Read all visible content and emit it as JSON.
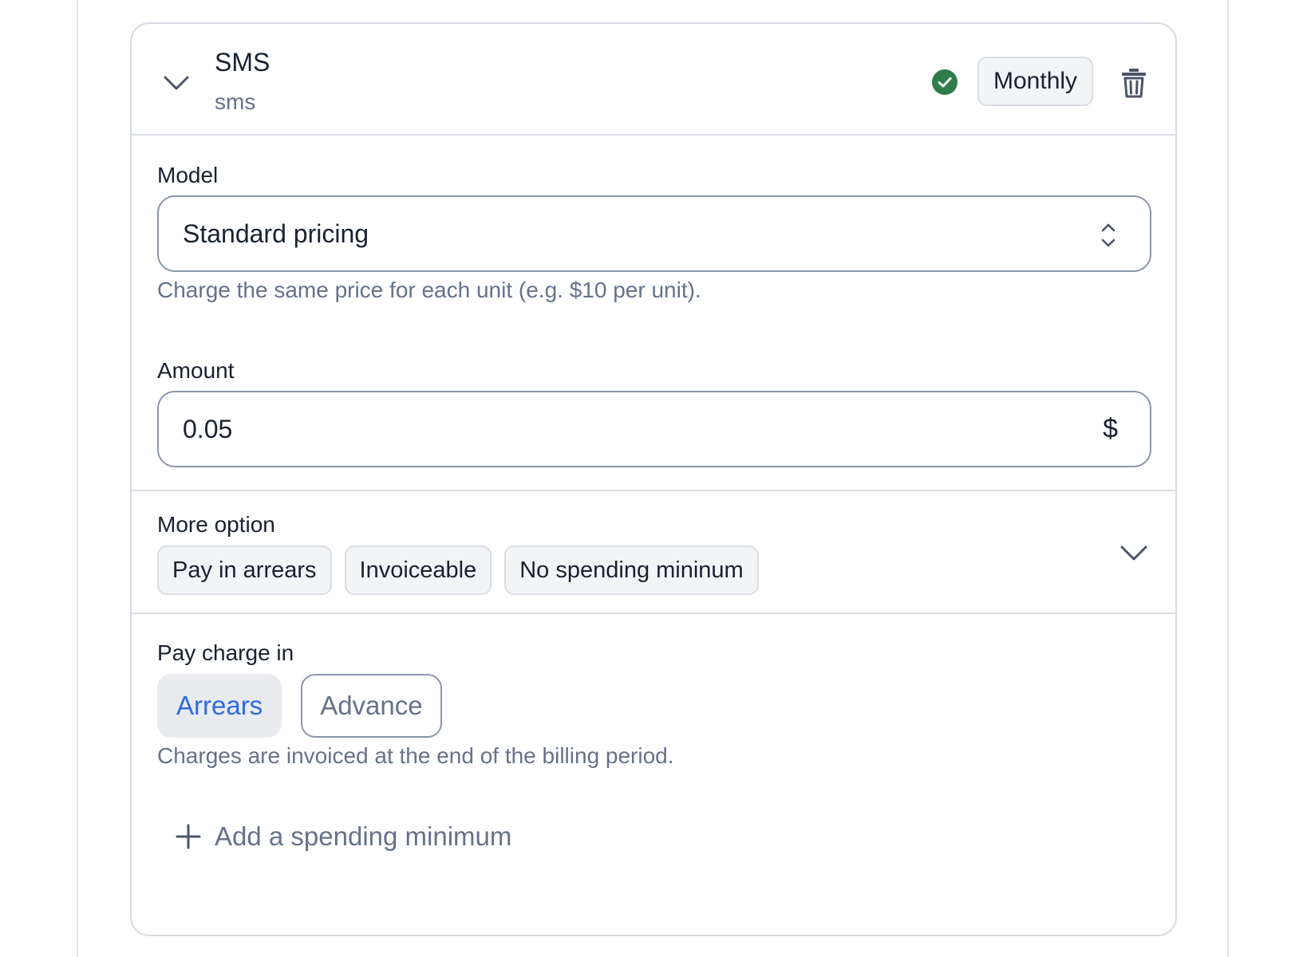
{
  "charge": {
    "title": "SMS",
    "code": "sms",
    "status_icon": "check-circle-icon",
    "status_color": "#2f7d4a",
    "interval": "Monthly"
  },
  "model": {
    "label": "Model",
    "selected": "Standard pricing",
    "helper": "Charge the same price for each unit (e.g. $10 per unit)."
  },
  "amount": {
    "label": "Amount",
    "value": "0.05",
    "currency_symbol": "$"
  },
  "more_options": {
    "label": "More option",
    "chips": [
      "Pay in arrears",
      "Invoiceable",
      "No spending mininum"
    ]
  },
  "pay_charge": {
    "label": "Pay charge in",
    "options": [
      "Arrears",
      "Advance"
    ],
    "selected": "Arrears",
    "helper": "Charges are invoiced at the end of the billing period."
  },
  "add_minimum": {
    "label": "Add a spending minimum"
  },
  "colors": {
    "accent": "#2e6ae6",
    "text_primary": "#19212e",
    "text_secondary": "#66728a",
    "border": "#d8dde3"
  }
}
